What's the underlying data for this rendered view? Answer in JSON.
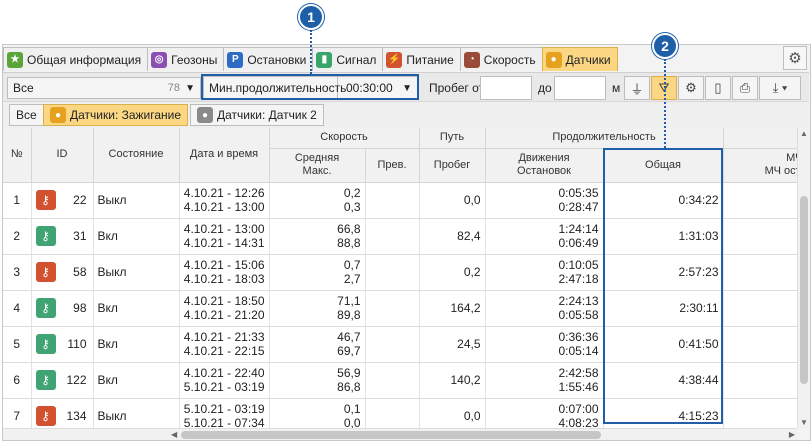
{
  "callouts": [
    "1",
    "2"
  ],
  "tabs": [
    {
      "label": "Общая информация",
      "icon": "star-icon",
      "color": "#5aa43a"
    },
    {
      "label": "Геозоны",
      "icon": "geofence-icon",
      "color": "#8a4fb0"
    },
    {
      "label": "Остановки",
      "icon": "parking-icon",
      "color": "#2e6bc4"
    },
    {
      "label": "Сигнал",
      "icon": "signal-icon",
      "color": "#3aa56a"
    },
    {
      "label": "Питание",
      "icon": "power-icon",
      "color": "#d2512e"
    },
    {
      "label": "Скорость",
      "icon": "speedometer-icon",
      "color": "#9a4a3a"
    },
    {
      "label": "Датчики",
      "icon": "sensor-icon",
      "color": "#e6a21e",
      "active": true
    }
  ],
  "toolbar": {
    "object_select": "Все",
    "object_count": "78",
    "min_duration_label": "Мин.продолжительность",
    "min_duration_value": "00:30:00",
    "run_from_label": "Пробег от",
    "run_to_label": "до",
    "run_unit": "м",
    "buttons": [
      "plug-icon",
      "filter-icon",
      "gear-icon",
      "phone-icon",
      "print-icon",
      "export-icon"
    ]
  },
  "subtabs": [
    {
      "label": "Все"
    },
    {
      "label": "Датчики: Зажигание",
      "active": true
    },
    {
      "label": "Датчики: Датчик 2"
    }
  ],
  "table": {
    "group_headers": {
      "speed": "Скорость",
      "path": "Путь",
      "duration": "Продолжительность"
    },
    "headers": {
      "num": "№",
      "id": "ID",
      "state": "Состояние",
      "datetime": "Дата и время",
      "speed_avg_1": "Средняя",
      "speed_avg_2": "Макс.",
      "speed_exceed": "Прев.",
      "mileage": "Пробег",
      "move_1": "Движения",
      "move_2": "Остановок",
      "total": "Общая",
      "mh_1": "МЧ",
      "mh_2": "МЧ ост."
    },
    "rows": [
      {
        "num": "1",
        "id": "22",
        "state": "Выкл",
        "on": false,
        "dt1": "4.10.21 - 12:26",
        "dt2": "4.10.21 - 13:00",
        "sp1": "0,2",
        "sp2": "0,3",
        "mileage": "0,0",
        "mv1": "0:05:35",
        "mv2": "0:28:47",
        "total": "0:34:22"
      },
      {
        "num": "2",
        "id": "31",
        "state": "Вкл",
        "on": true,
        "dt1": "4.10.21 - 13:00",
        "dt2": "4.10.21 - 14:31",
        "sp1": "66,8",
        "sp2": "88,8",
        "mileage": "82,4",
        "mv1": "1:24:14",
        "mv2": "0:06:49",
        "total": "1:31:03"
      },
      {
        "num": "3",
        "id": "58",
        "state": "Выкл",
        "on": false,
        "dt1": "4.10.21 - 15:06",
        "dt2": "4.10.21 - 18:03",
        "sp1": "0,7",
        "sp2": "2,7",
        "mileage": "0,2",
        "mv1": "0:10:05",
        "mv2": "2:47:18",
        "total": "2:57:23"
      },
      {
        "num": "4",
        "id": "98",
        "state": "Вкл",
        "on": true,
        "dt1": "4.10.21 - 18:50",
        "dt2": "4.10.21 - 21:20",
        "sp1": "71,1",
        "sp2": "89,8",
        "mileage": "164,2",
        "mv1": "2:24:13",
        "mv2": "0:05:58",
        "total": "2:30:11"
      },
      {
        "num": "5",
        "id": "110",
        "state": "Вкл",
        "on": true,
        "dt1": "4.10.21 - 21:33",
        "dt2": "4.10.21 - 22:15",
        "sp1": "46,7",
        "sp2": "69,7",
        "mileage": "24,5",
        "mv1": "0:36:36",
        "mv2": "0:05:14",
        "total": "0:41:50"
      },
      {
        "num": "6",
        "id": "122",
        "state": "Вкл",
        "on": true,
        "dt1": "4.10.21 - 22:40",
        "dt2": "5.10.21 - 03:19",
        "sp1": "56,9",
        "sp2": "86,8",
        "mileage": "140,2",
        "mv1": "2:42:58",
        "mv2": "1:55:46",
        "total": "4:38:44"
      },
      {
        "num": "7",
        "id": "134",
        "state": "Выкл",
        "on": false,
        "dt1": "5.10.21 - 03:19",
        "dt2": "5.10.21 - 07:34",
        "sp1": "0,1",
        "sp2": "0,0",
        "mileage": "0,0",
        "mv1": "0:07:00",
        "mv2": "4:08:23",
        "total": "4:15:23"
      }
    ]
  },
  "colors": {
    "accent": "#1f5fa8",
    "active_tab": "#fbd784",
    "key_off": "#d2512e",
    "key_on": "#3fa374"
  }
}
